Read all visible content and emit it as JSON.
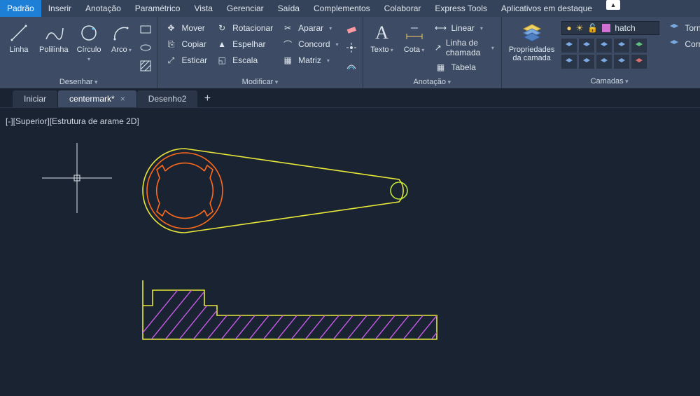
{
  "menu": {
    "items": [
      "Padrão",
      "Inserir",
      "Anotação",
      "Paramétrico",
      "Vista",
      "Gerenciar",
      "Saída",
      "Complementos",
      "Colaborar",
      "Express Tools",
      "Aplicativos em destaque"
    ],
    "active": 0
  },
  "ribbon": {
    "draw": {
      "title": "Desenhar",
      "linha": "Linha",
      "polilinha": "Polilinha",
      "circulo": "Círculo",
      "arco": "Arco"
    },
    "modify": {
      "title": "Modificar",
      "mover": "Mover",
      "copiar": "Copiar",
      "esticar": "Esticar",
      "rotacionar": "Rotacionar",
      "espelhar": "Espelhar",
      "escala": "Escala",
      "aparar": "Aparar",
      "concord": "Concord",
      "matriz": "Matriz"
    },
    "annotate": {
      "title": "Anotação",
      "texto": "Texto",
      "cota": "Cota",
      "linear": "Linear",
      "leader": "Linha de chamada",
      "tabela": "Tabela"
    },
    "layers": {
      "title": "Camadas",
      "prop": "Propriedades",
      "prop2": "da camada",
      "current": "hatch",
      "side1": "Tornar",
      "side2": "Corres"
    }
  },
  "tabs": {
    "items": [
      "Iniciar",
      "centermark*",
      "Desenho2"
    ],
    "active": 1
  },
  "view": {
    "label": "[-][Superior][Estrutura de arame 2D]"
  },
  "colors": {
    "yellow": "#e8e838",
    "orange": "#ff6a1a",
    "magenta": "#c85ae8",
    "green": "#b8e838"
  }
}
